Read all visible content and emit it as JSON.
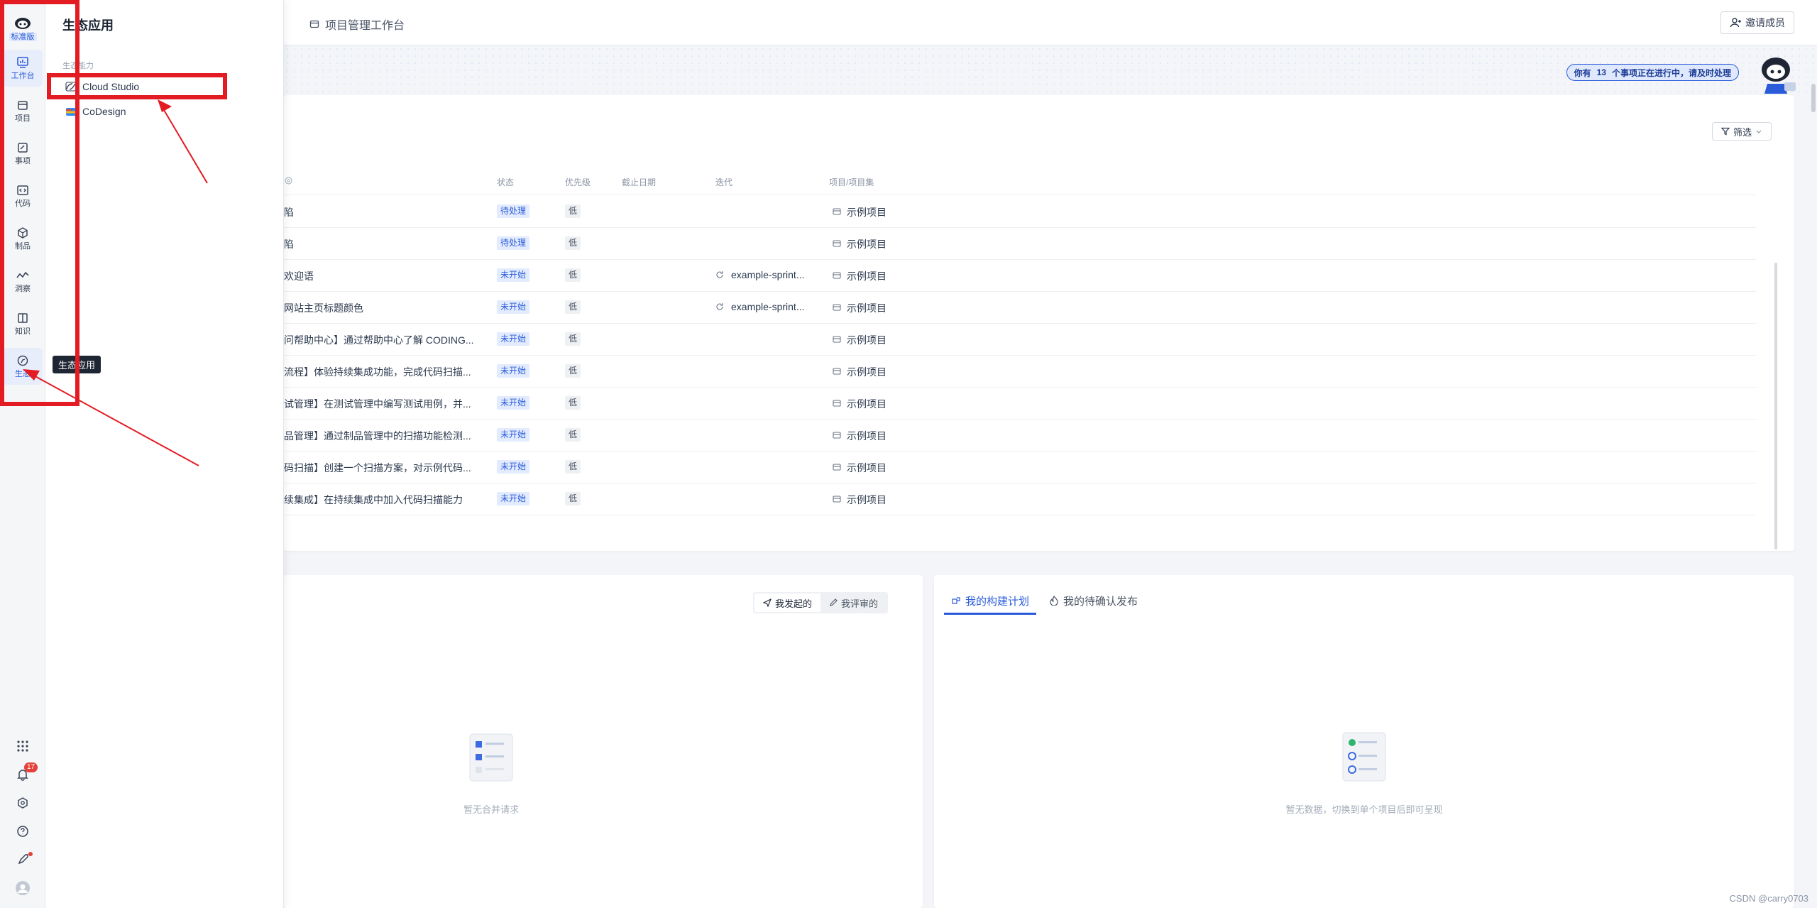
{
  "rail": {
    "logo_label": "标准版",
    "items": [
      {
        "label": "工作台",
        "icon": "dashboard-icon"
      },
      {
        "label": "项目",
        "icon": "folder-icon"
      },
      {
        "label": "事项",
        "icon": "edit-doc-icon"
      },
      {
        "label": "代码",
        "icon": "code-icon"
      },
      {
        "label": "制品",
        "icon": "package-icon"
      },
      {
        "label": "洞察",
        "icon": "chart-line-icon"
      },
      {
        "label": "知识",
        "icon": "book-icon"
      },
      {
        "label": "生态",
        "icon": "ecosystem-icon"
      }
    ],
    "notification_count": "17"
  },
  "eco_panel": {
    "title": "生态应用",
    "section": "生态能力",
    "items": [
      {
        "label": "Cloud Studio"
      },
      {
        "label": "CoDesign"
      }
    ]
  },
  "tooltip": "生态应用",
  "topbar": {
    "breadcrumb": "项目管理工作台",
    "invite": "邀请成员"
  },
  "banner": {
    "notice_prefix": "你有",
    "notice_count": "13",
    "notice_suffix": "个事项正在进行中，请及时处理"
  },
  "issues": {
    "filter": "筛选",
    "columns": [
      "状态",
      "优先级",
      "截止日期",
      "迭代",
      "项目/项目集"
    ],
    "rows": [
      {
        "title": "陷",
        "status": "待处理",
        "priority": "低",
        "deadline": "",
        "sprint": "",
        "project": "示例项目"
      },
      {
        "title": "陷",
        "status": "待处理",
        "priority": "低",
        "deadline": "",
        "sprint": "",
        "project": "示例项目"
      },
      {
        "title": "欢迎语",
        "status": "未开始",
        "priority": "低",
        "deadline": "",
        "sprint": "example-sprint...",
        "project": "示例项目"
      },
      {
        "title": "网站主页标题颜色",
        "status": "未开始",
        "priority": "低",
        "deadline": "",
        "sprint": "example-sprint...",
        "project": "示例项目"
      },
      {
        "title": "问帮助中心】通过帮助中心了解 CODING...",
        "status": "未开始",
        "priority": "低",
        "deadline": "",
        "sprint": "",
        "project": "示例项目"
      },
      {
        "title": "流程】体验持续集成功能，完成代码扫描...",
        "status": "未开始",
        "priority": "低",
        "deadline": "",
        "sprint": "",
        "project": "示例项目"
      },
      {
        "title": "试管理】在测试管理中编写测试用例，并...",
        "status": "未开始",
        "priority": "低",
        "deadline": "",
        "sprint": "",
        "project": "示例项目"
      },
      {
        "title": "品管理】通过制品管理中的扫描功能检测...",
        "status": "未开始",
        "priority": "低",
        "deadline": "",
        "sprint": "",
        "project": "示例项目"
      },
      {
        "title": "码扫描】创建一个扫描方案，对示例代码...",
        "status": "未开始",
        "priority": "低",
        "deadline": "",
        "sprint": "",
        "project": "示例项目"
      },
      {
        "title": "续集成】在持续集成中加入代码扫描能力",
        "status": "未开始",
        "priority": "低",
        "deadline": "",
        "sprint": "",
        "project": "示例项目"
      }
    ]
  },
  "merge": {
    "seg_initiated": "我发起的",
    "seg_reviewed": "我评审的",
    "empty": "暂无合并请求"
  },
  "build": {
    "tab_build": "我的构建计划",
    "tab_release": "我的待确认发布",
    "empty": "暂无数据，切换到单个项目后即可呈现"
  },
  "watermark": "CSDN @carry0703",
  "colors": {
    "accent": "#2a5cd9",
    "highlight": "#e31b23"
  }
}
